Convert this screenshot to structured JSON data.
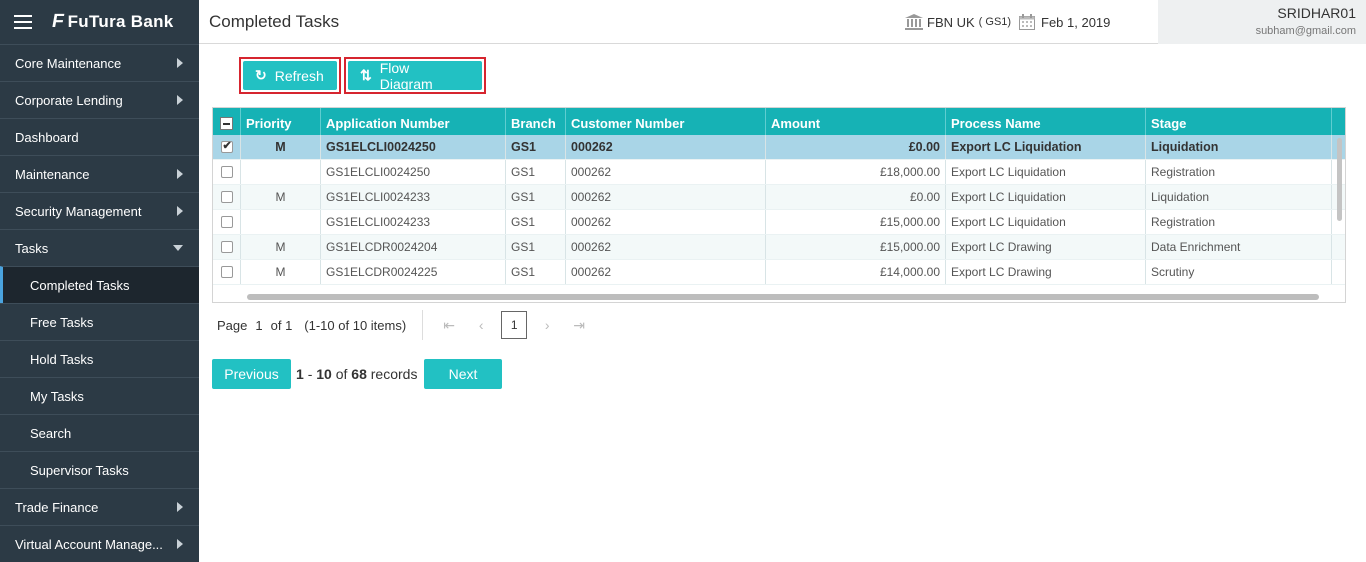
{
  "brand": {
    "name": "FuTura Bank",
    "logo_mark": "F"
  },
  "sidebar": {
    "items": [
      {
        "label": "Core Maintenance",
        "expandable": true
      },
      {
        "label": "Corporate Lending",
        "expandable": true
      },
      {
        "label": "Dashboard",
        "expandable": false
      },
      {
        "label": "Maintenance",
        "expandable": true
      },
      {
        "label": "Security Management",
        "expandable": true
      },
      {
        "label": "Tasks",
        "expanded": true
      },
      {
        "label": "Trade Finance",
        "expandable": true
      },
      {
        "label": "Virtual Account Manage...",
        "expandable": true
      }
    ],
    "task_sub_items": [
      {
        "label": "Completed Tasks",
        "active": true
      },
      {
        "label": "Free Tasks"
      },
      {
        "label": "Hold Tasks"
      },
      {
        "label": "My Tasks"
      },
      {
        "label": "Search"
      },
      {
        "label": "Supervisor Tasks"
      }
    ]
  },
  "header": {
    "title": "Completed Tasks",
    "branch": "FBN UK",
    "branch_code": "( GS1)",
    "date": "Feb 1, 2019",
    "user_name": "SRIDHAR01",
    "user_email": "subham@gmail.com"
  },
  "toolbar": {
    "refresh_label": "Refresh",
    "flow_diagram_label": "Flow Diagram"
  },
  "grid": {
    "columns": [
      "Priority",
      "Application Number",
      "Branch",
      "Customer Number",
      "Amount",
      "Process Name",
      "Stage"
    ],
    "rows": [
      {
        "checked": true,
        "priority": "M",
        "application_number": "GS1ELCLI0024250",
        "branch": "GS1",
        "customer_number": "000262",
        "amount": "£0.00",
        "process_name": "Export LC Liquidation",
        "stage": "Liquidation"
      },
      {
        "checked": false,
        "priority": "",
        "application_number": "GS1ELCLI0024250",
        "branch": "GS1",
        "customer_number": "000262",
        "amount": "£18,000.00",
        "process_name": "Export LC Liquidation",
        "stage": "Registration"
      },
      {
        "checked": false,
        "priority": "M",
        "application_number": "GS1ELCLI0024233",
        "branch": "GS1",
        "customer_number": "000262",
        "amount": "£0.00",
        "process_name": "Export LC Liquidation",
        "stage": "Liquidation"
      },
      {
        "checked": false,
        "priority": "",
        "application_number": "GS1ELCLI0024233",
        "branch": "GS1",
        "customer_number": "000262",
        "amount": "£15,000.00",
        "process_name": "Export LC Liquidation",
        "stage": "Registration"
      },
      {
        "checked": false,
        "priority": "M",
        "application_number": "GS1ELCDR0024204",
        "branch": "GS1",
        "customer_number": "000262",
        "amount": "£15,000.00",
        "process_name": "Export LC Drawing",
        "stage": "Data Enrichment"
      },
      {
        "checked": false,
        "priority": "M",
        "application_number": "GS1ELCDR0024225",
        "branch": "GS1",
        "customer_number": "000262",
        "amount": "£14,000.00",
        "process_name": "Export LC Drawing",
        "stage": "Scrutiny"
      }
    ]
  },
  "pager": {
    "page_label": "Page",
    "current": "1",
    "of_label": "of 1",
    "items_info": "(1-10 of 10 items)",
    "page_box": "1"
  },
  "records": {
    "previous_label": "Previous",
    "next_label": "Next",
    "range_start": "1",
    "dash": "-",
    "range_end": "10",
    "of_label": "of",
    "total": "68",
    "records_label": "records"
  },
  "colors": {
    "accent": "#22c1c3",
    "grid_header": "#16b2b5",
    "sidebar_bg": "#2c3a45",
    "highlight_border": "#d6252f",
    "selected_row": "#a9d5e7"
  }
}
